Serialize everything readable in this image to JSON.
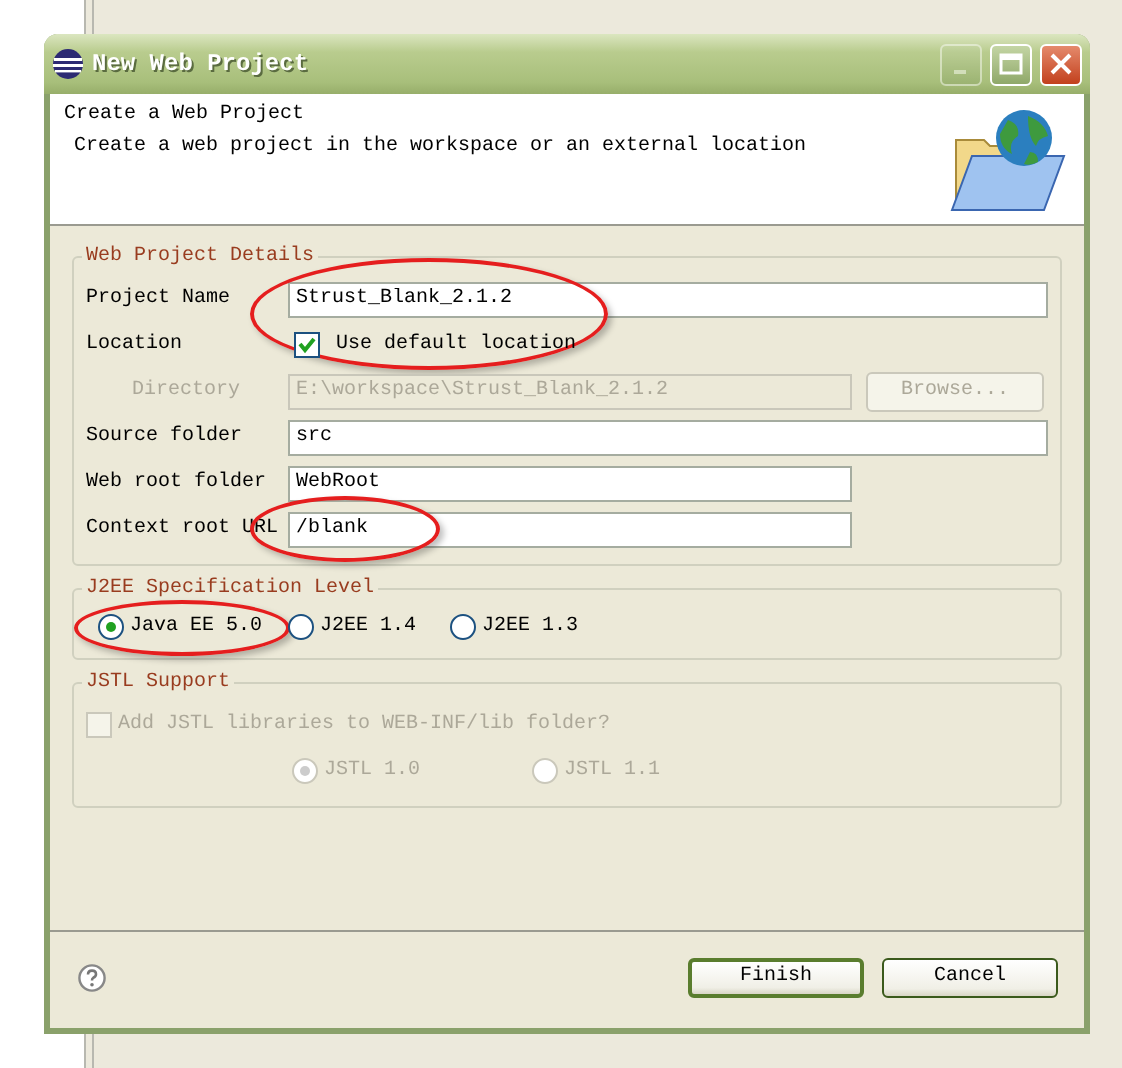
{
  "window": {
    "title": "New Web Project",
    "title_buttons": [
      {
        "kind": "minimize",
        "disabled": true
      },
      {
        "kind": "maximize",
        "disabled": false
      },
      {
        "kind": "close",
        "disabled": false
      }
    ]
  },
  "header": {
    "title": "Create a Web Project",
    "description": "Create a web project in the workspace or an external location"
  },
  "details": {
    "legend": "Web Project Details",
    "rows": [
      {
        "kind": "text",
        "label": "Project Name",
        "value": "Strust_Blank_2.1.2",
        "wide": true,
        "disabled": false,
        "circled": true
      },
      {
        "kind": "checkbox",
        "label": "Location",
        "text": "Use default location",
        "checked": true,
        "disabled": false,
        "circled": true
      },
      {
        "kind": "path",
        "label": "Directory",
        "value": "E:\\workspace\\Strust_Blank_2.1.2",
        "wide": false,
        "disabled": true,
        "button": "Browse...",
        "circled": false
      },
      {
        "kind": "text",
        "label": "Source folder",
        "value": "src",
        "wide": true,
        "disabled": false,
        "circled": false
      },
      {
        "kind": "text",
        "label": "Web root folder",
        "value": "WebRoot",
        "wide": false,
        "disabled": false,
        "circled": false
      },
      {
        "kind": "text",
        "label": "Context root URL",
        "value": "/blank",
        "wide": false,
        "disabled": false,
        "circled": true
      }
    ]
  },
  "j2ee": {
    "legend": "J2EE Specification Level",
    "options": [
      {
        "label": "Java EE 5.0",
        "selected": true,
        "circled": true
      },
      {
        "label": "J2EE 1.4",
        "selected": false,
        "circled": false
      },
      {
        "label": "J2EE 1.3",
        "selected": false,
        "circled": false
      }
    ]
  },
  "jstl": {
    "legend": "JSTL Support",
    "disabled": true,
    "checkbox": {
      "label": "Add JSTL libraries to WEB-INF/lib folder?",
      "checked": false
    },
    "options": [
      {
        "label": "JSTL 1.0",
        "selected": true
      },
      {
        "label": "JSTL 1.1",
        "selected": false
      }
    ]
  },
  "buttons": [
    {
      "label": "Finish",
      "default": true
    },
    {
      "label": "Cancel",
      "default": false
    }
  ]
}
